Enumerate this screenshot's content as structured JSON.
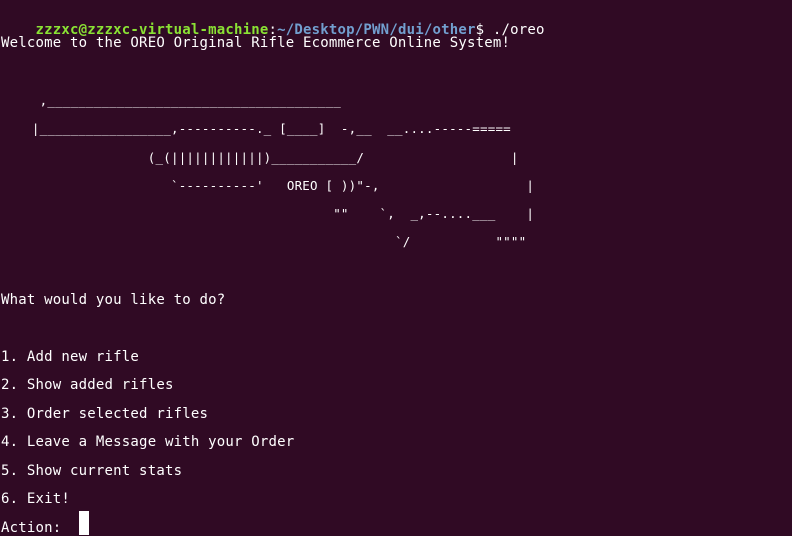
{
  "prompt": {
    "user_host": "zzzxc@zzzxc-virtual-machine",
    "separator": ":",
    "path": "~/Desktop/PWN/dui/other",
    "symbol": "$",
    "command": " ./oreo"
  },
  "welcome": "Welcome to the OREO Original Rifle Ecommerce Online System!",
  "ascii_art": [
    "     ,______________________________________",
    "    |_________________,----------._ [____]  -,__  __....-----=====",
    "                   (_(||||||||||||)___________/                   |",
    "                      `----------'   OREO [ ))\"-,                   |",
    "                                           \"\"    `,  _,--....___    |",
    "                                                   `/           \"\"\"\""
  ],
  "question": "What would you like to do?",
  "menu": [
    "1. Add new rifle",
    "2. Show added rifles",
    "3. Order selected rifles",
    "4. Leave a Message with your Order",
    "5. Show current stats",
    "6. Exit!"
  ],
  "action_prompt": "Action: ",
  "colors": {
    "background": "#300a24",
    "text": "#ffffff",
    "user_host": "#8ae234",
    "path": "#729fcf"
  }
}
